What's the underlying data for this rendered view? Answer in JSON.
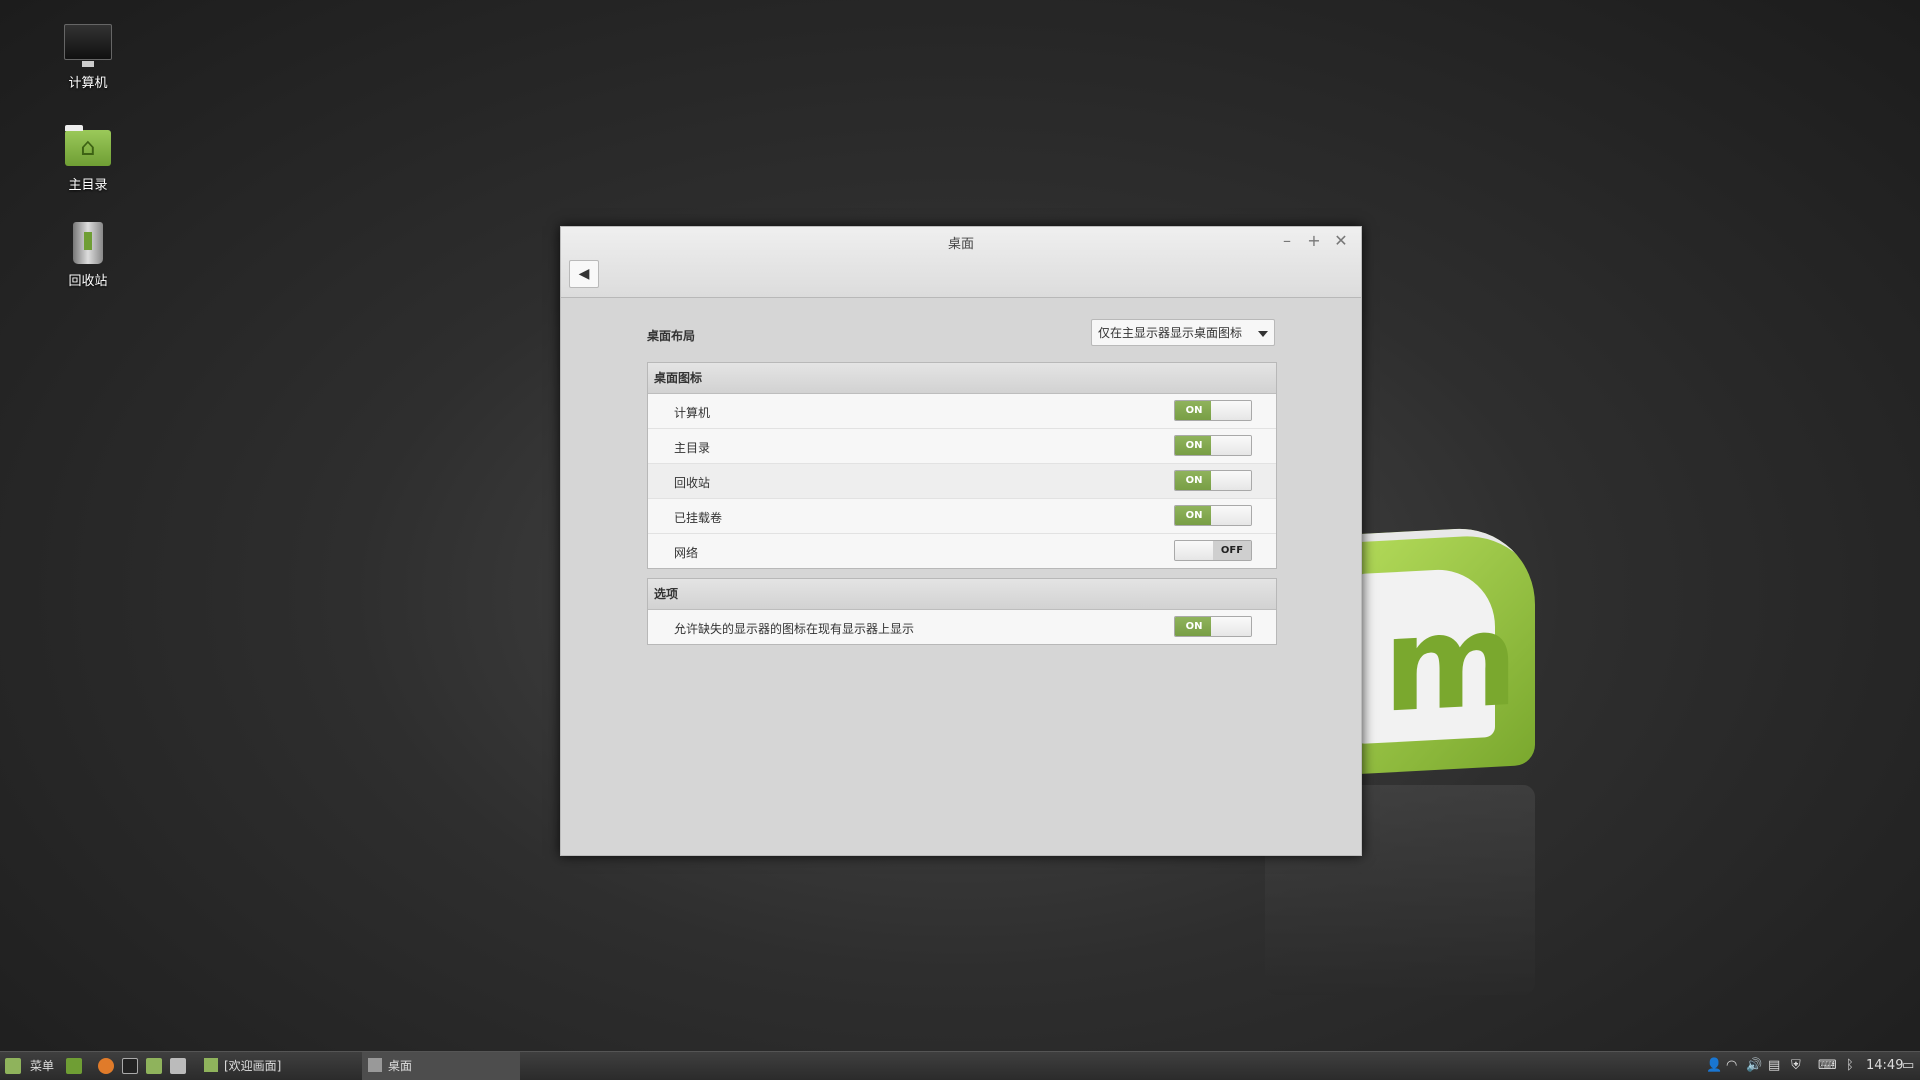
{
  "desktop": {
    "icons": [
      {
        "label": "计算机",
        "icon": "monitor-icon"
      },
      {
        "label": "主目录",
        "icon": "home-folder-icon"
      },
      {
        "label": "回收站",
        "icon": "trash-icon"
      }
    ]
  },
  "window": {
    "title": "桌面",
    "controls": {
      "minimize": "–",
      "maximize": "+",
      "close": "✕"
    },
    "back_icon": "arrow-left-icon",
    "layout": {
      "label": "桌面布局",
      "selected": "仅在主显示器显示桌面图标"
    },
    "icons_section": {
      "header": "桌面图标",
      "rows": [
        {
          "label": "计算机",
          "state": "ON"
        },
        {
          "label": "主目录",
          "state": "ON"
        },
        {
          "label": "回收站",
          "state": "ON"
        },
        {
          "label": "已挂载卷",
          "state": "ON"
        },
        {
          "label": "网络",
          "state": "OFF"
        }
      ]
    },
    "options_section": {
      "header": "选项",
      "rows": [
        {
          "label": "允许缺失的显示器的图标在现有显示器上显示",
          "state": "ON"
        }
      ]
    }
  },
  "taskbar": {
    "menu_label": "菜单",
    "tasks": [
      {
        "label": "[欢迎画面]",
        "active": false
      },
      {
        "label": "桌面",
        "active": true
      }
    ],
    "clock": "14:49",
    "accent": "#8fb35c"
  }
}
